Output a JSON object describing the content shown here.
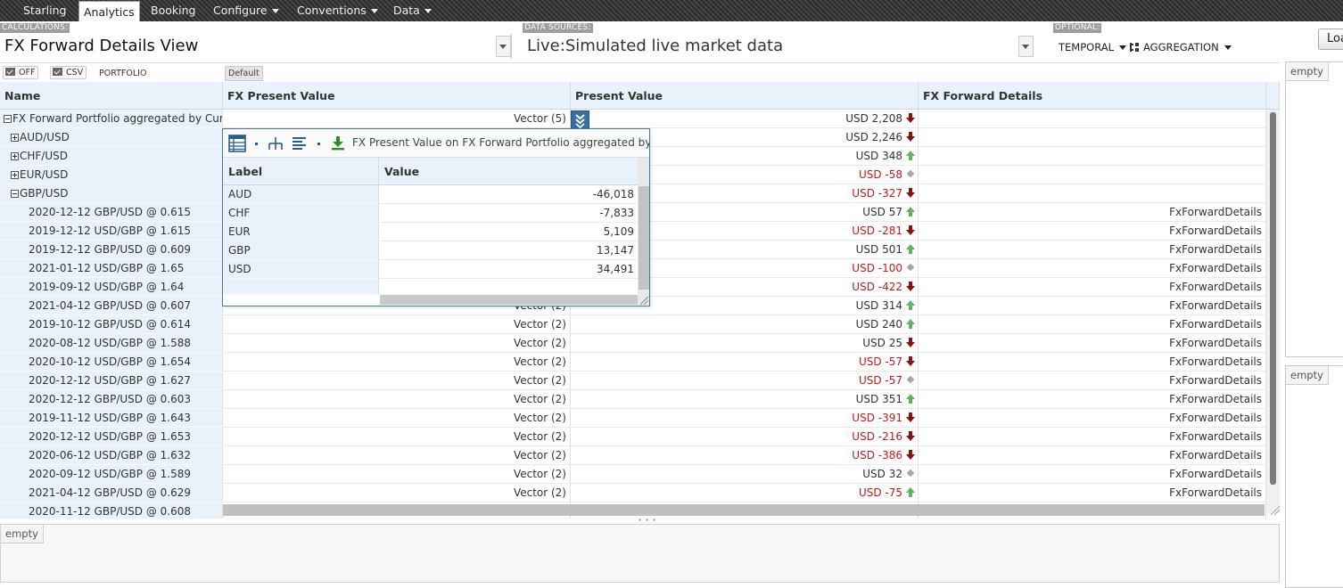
{
  "menu": {
    "items": [
      {
        "label": "Starling",
        "has_dropdown": false,
        "active": false
      },
      {
        "label": "Analytics",
        "has_dropdown": false,
        "active": true
      },
      {
        "label": "Booking",
        "has_dropdown": false,
        "active": false
      },
      {
        "label": "Configure",
        "has_dropdown": true,
        "active": false
      },
      {
        "label": "Conventions",
        "has_dropdown": true,
        "active": false
      },
      {
        "label": "Data",
        "has_dropdown": true,
        "active": false
      }
    ]
  },
  "selectors": {
    "calculations_label": "CALCULATIONS:",
    "calculation_value": "FX Forward Details View",
    "data_sources_label": "DATA SOURCES:",
    "data_source_value": "Live:Simulated live market data",
    "optional_label": "OPTIONAL:",
    "temporal_label": "TEMPORAL",
    "aggregation_label": "AGGREGATION",
    "load_button": "Loa"
  },
  "toolbar": {
    "off_label": "OFF",
    "csv_label": "CSV",
    "portfolio_label": "PORTFOLIO",
    "default_tab": "Default"
  },
  "grid": {
    "columns": [
      "Name",
      "FX Present Value",
      "Present Value",
      "FX Forward Details"
    ],
    "rows": [
      {
        "name": "FX Forward Portfolio aggregated by Curr...",
        "level": 0,
        "expander": "minus",
        "fx": "Vector (5)",
        "pv": "USD 2,208",
        "pv_neg": false,
        "trend": "down",
        "fd": ""
      },
      {
        "name": "AUD/USD",
        "level": 1,
        "expander": "plus",
        "fx": "",
        "pv": "USD 2,246",
        "pv_neg": false,
        "trend": "down",
        "fd": ""
      },
      {
        "name": "CHF/USD",
        "level": 1,
        "expander": "plus",
        "fx": "",
        "pv": "USD 348",
        "pv_neg": false,
        "trend": "up",
        "fd": ""
      },
      {
        "name": "EUR/USD",
        "level": 1,
        "expander": "plus",
        "fx": "",
        "pv": "USD -58",
        "pv_neg": true,
        "trend": "flat",
        "fd": ""
      },
      {
        "name": "GBP/USD",
        "level": 1,
        "expander": "minus",
        "fx": "",
        "pv": "USD -327",
        "pv_neg": true,
        "trend": "down",
        "fd": ""
      },
      {
        "name": "2020-12-12 GBP/USD @ 0.615",
        "level": 2,
        "expander": "",
        "fx": "",
        "pv": "USD 57",
        "pv_neg": false,
        "trend": "up",
        "fd": "FxForwardDetails"
      },
      {
        "name": "2019-12-12 USD/GBP @ 1.615",
        "level": 2,
        "expander": "",
        "fx": "",
        "pv": "USD -281",
        "pv_neg": true,
        "trend": "down",
        "fd": "FxForwardDetails"
      },
      {
        "name": "2019-12-12 GBP/USD @ 0.609",
        "level": 2,
        "expander": "",
        "fx": "",
        "pv": "USD 501",
        "pv_neg": false,
        "trend": "up",
        "fd": "FxForwardDetails"
      },
      {
        "name": "2021-01-12 USD/GBP @ 1.65",
        "level": 2,
        "expander": "",
        "fx": "",
        "pv": "USD -100",
        "pv_neg": true,
        "trend": "flat",
        "fd": "FxForwardDetails"
      },
      {
        "name": "2019-09-12 USD/GBP @ 1.64",
        "level": 2,
        "expander": "",
        "fx": "",
        "pv": "USD -422",
        "pv_neg": true,
        "trend": "down",
        "fd": "FxForwardDetails"
      },
      {
        "name": "2021-04-12 GBP/USD @ 0.607",
        "level": 2,
        "expander": "",
        "fx": "Vector (2)",
        "pv": "USD 314",
        "pv_neg": false,
        "trend": "up",
        "fd": "FxForwardDetails"
      },
      {
        "name": "2019-10-12 GBP/USD @ 0.614",
        "level": 2,
        "expander": "",
        "fx": "Vector (2)",
        "pv": "USD 240",
        "pv_neg": false,
        "trend": "up",
        "fd": "FxForwardDetails"
      },
      {
        "name": "2020-08-12 USD/GBP @ 1.588",
        "level": 2,
        "expander": "",
        "fx": "Vector (2)",
        "pv": "USD 25",
        "pv_neg": false,
        "trend": "down",
        "fd": "FxForwardDetails"
      },
      {
        "name": "2020-10-12 USD/GBP @ 1.654",
        "level": 2,
        "expander": "",
        "fx": "Vector (2)",
        "pv": "USD -57",
        "pv_neg": true,
        "trend": "down",
        "fd": "FxForwardDetails"
      },
      {
        "name": "2020-12-12 USD/GBP @ 1.627",
        "level": 2,
        "expander": "",
        "fx": "Vector (2)",
        "pv": "USD -57",
        "pv_neg": true,
        "trend": "flat",
        "fd": "FxForwardDetails"
      },
      {
        "name": "2020-12-12 GBP/USD @ 0.603",
        "level": 2,
        "expander": "",
        "fx": "Vector (2)",
        "pv": "USD 351",
        "pv_neg": false,
        "trend": "up",
        "fd": "FxForwardDetails"
      },
      {
        "name": "2019-11-12 USD/GBP @ 1.643",
        "level": 2,
        "expander": "",
        "fx": "Vector (2)",
        "pv": "USD -391",
        "pv_neg": true,
        "trend": "down",
        "fd": "FxForwardDetails"
      },
      {
        "name": "2020-12-12 USD/GBP @ 1.653",
        "level": 2,
        "expander": "",
        "fx": "Vector (2)",
        "pv": "USD -216",
        "pv_neg": true,
        "trend": "down",
        "fd": "FxForwardDetails"
      },
      {
        "name": "2020-06-12 USD/GBP @ 1.632",
        "level": 2,
        "expander": "",
        "fx": "Vector (2)",
        "pv": "USD -386",
        "pv_neg": true,
        "trend": "down",
        "fd": "FxForwardDetails"
      },
      {
        "name": "2020-09-12 USD/GBP @ 1.589",
        "level": 2,
        "expander": "",
        "fx": "Vector (2)",
        "pv": "USD 32",
        "pv_neg": false,
        "trend": "flat",
        "fd": "FxForwardDetails"
      },
      {
        "name": "2021-04-12 GBP/USD @ 0.629",
        "level": 2,
        "expander": "",
        "fx": "Vector (2)",
        "pv": "USD -75",
        "pv_neg": true,
        "trend": "up",
        "fd": "FxForwardDetails"
      },
      {
        "name": "2020-11-12 GBP/USD @ 0.608",
        "level": 2,
        "expander": "",
        "fx": "",
        "pv": "",
        "pv_neg": false,
        "trend": "",
        "fd": ""
      }
    ]
  },
  "popup": {
    "title": "FX Present Value on FX Forward Portfolio aggregated by Cur",
    "columns": [
      "Label",
      "Value"
    ],
    "rows": [
      {
        "label": "AUD",
        "value": "-46,018"
      },
      {
        "label": "CHF",
        "value": "-7,833"
      },
      {
        "label": "EUR",
        "value": "5,109"
      },
      {
        "label": "GBP",
        "value": "13,147"
      },
      {
        "label": "USD",
        "value": "34,491"
      }
    ]
  },
  "side_panels": {
    "top_tab": "empty",
    "middle_tab": "empty",
    "bottom_tab": "empty"
  },
  "colors": {
    "negative": "#c31a1a",
    "trend_up": "#5fb55f",
    "trend_down": "#8b1111",
    "header_bg": "#e9f2fa",
    "accent": "#3b6fa0"
  },
  "icons": {
    "menu_caret": "caret-down-icon",
    "grid_view": "grid-view-icon",
    "hierarchy": "hierarchy-icon",
    "list": "list-icon",
    "download": "download-icon",
    "expand_all": "double-chevron-down-icon",
    "trend_up": "trend-up-arrow-icon",
    "trend_down": "trend-down-arrow-icon",
    "trend_flat": "trend-flat-diamond-icon"
  }
}
